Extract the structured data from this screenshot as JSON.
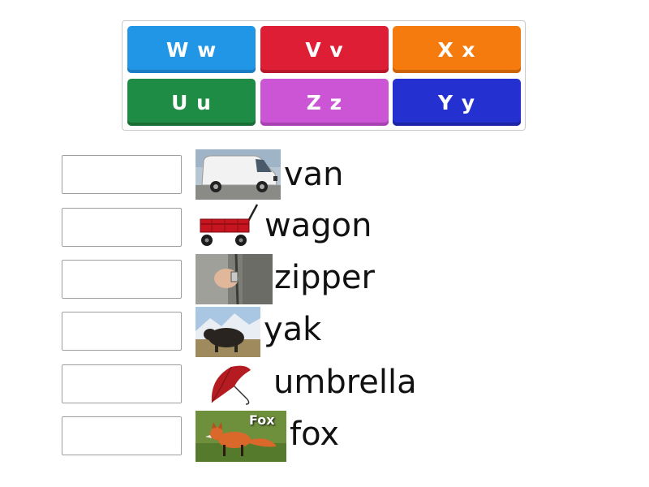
{
  "tiles": [
    {
      "label": "W w",
      "color": "#2196e6",
      "shade": "#1a7cc2"
    },
    {
      "label": "V v",
      "color": "#dd1e35",
      "shade": "#b8172b"
    },
    {
      "label": "X x",
      "color": "#f57b0f",
      "shade": "#cc640a"
    },
    {
      "label": "U u",
      "color": "#1e8c44",
      "shade": "#166e35"
    },
    {
      "label": "Z z",
      "color": "#cc55d6",
      "shade": "#a841b1"
    },
    {
      "label": "Y y",
      "color": "#2430cf",
      "shade": "#1b25a6"
    }
  ],
  "items": [
    {
      "word": "van",
      "image": "van-image"
    },
    {
      "word": "wagon",
      "image": "wagon-image"
    },
    {
      "word": "zipper",
      "image": "zipper-image"
    },
    {
      "word": "yak",
      "image": "yak-image"
    },
    {
      "word": "umbrella",
      "image": "umbrella-image"
    },
    {
      "word": "fox",
      "image": "fox-image",
      "image_caption": "Fox"
    }
  ]
}
